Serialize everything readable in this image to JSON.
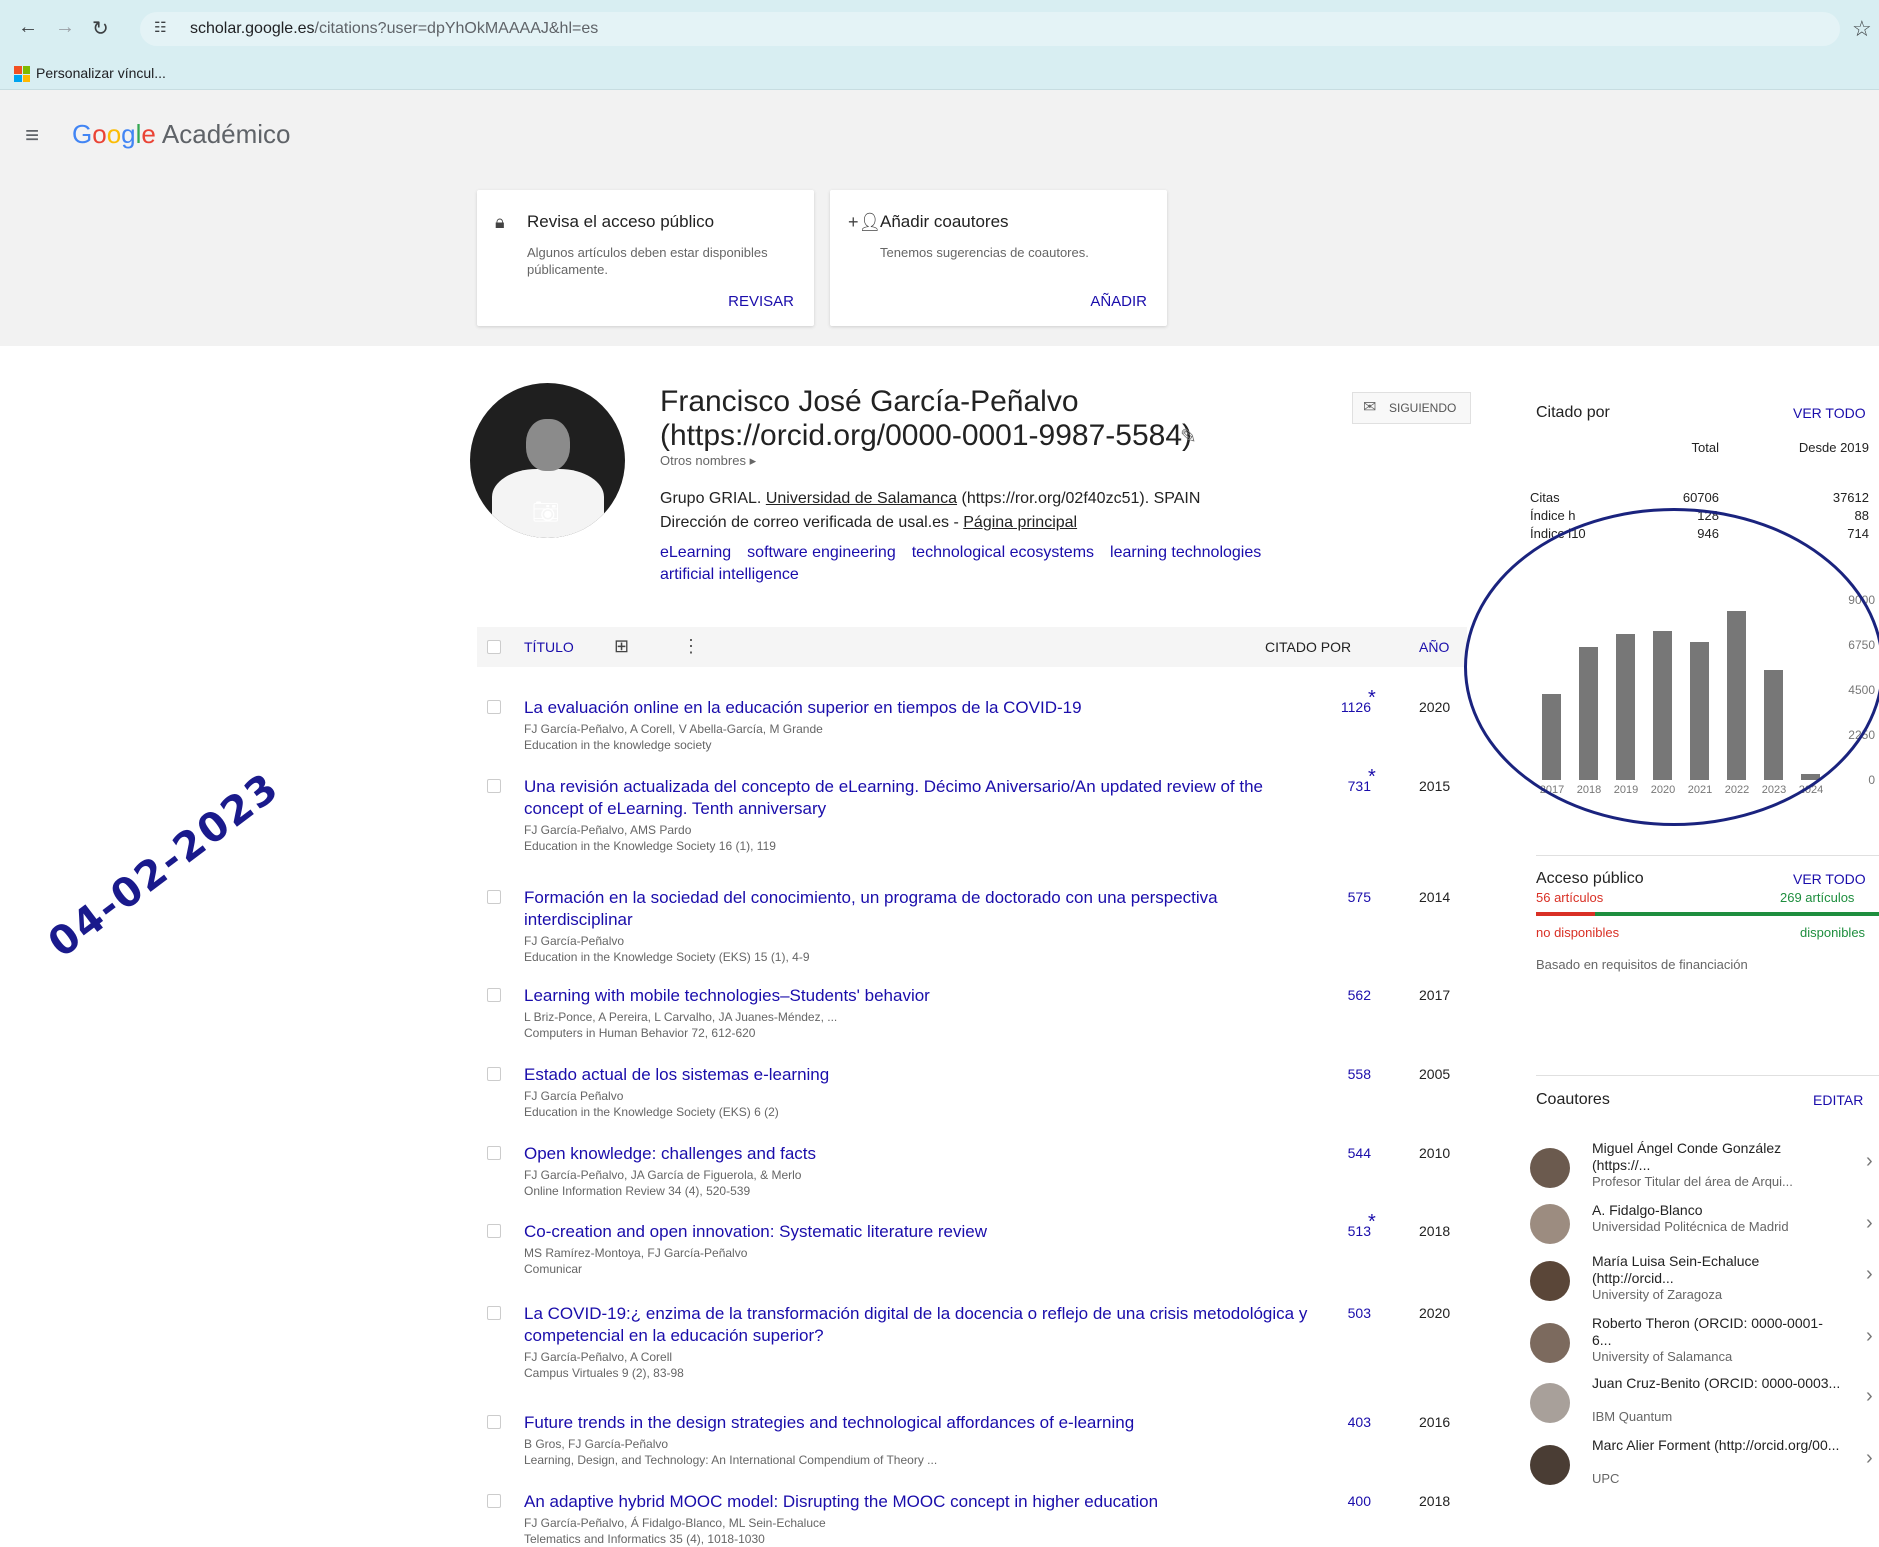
{
  "browser": {
    "url_host": "scholar.google.es",
    "url_path": "/citations?user=dpYhOkMAAAAJ&hl=es",
    "bookmark": "Personalizar víncul...",
    "icons": {
      "back": "back-arrow-icon",
      "forward": "forward-arrow-icon",
      "reload": "reload-icon",
      "site_settings": "tune-icon",
      "bookmark_star": "star-icon"
    }
  },
  "header": {
    "brand_google": "Google",
    "brand_product": "Académico"
  },
  "cards": [
    {
      "title": "Revisa el acceso público",
      "desc": "Algunos artículos deben estar disponibles públicamente.",
      "action": "REVISAR",
      "icon": "lock-icon"
    },
    {
      "title": "Añadir coautores",
      "desc": "Tenemos sugerencias de coautores.",
      "action": "AÑADIR",
      "icon": "add-person-icon"
    }
  ],
  "profile": {
    "name": "Francisco José García-Peñalvo (https://orcid.org/0000-0001-9987-5584)",
    "other_names": "Otros nombres ▸",
    "affil_prefix": "Grupo GRIAL. ",
    "affil_link": "Universidad de Salamanca",
    "affil_suffix": " (https://ror.org/02f40zc51). SPAIN",
    "email_prefix": "Dirección de correo verificada de usal.es - ",
    "email_link": "Página principal",
    "interests": [
      "eLearning",
      "software engineering",
      "technological ecosystems",
      "learning technologies",
      "artificial intelligence"
    ],
    "follow": "SIGUIENDO"
  },
  "table": {
    "header": {
      "title": "TÍTULO",
      "cited": "CITADO POR",
      "year": "AÑO"
    },
    "rows": [
      {
        "title": "La evaluación online en la educación superior en tiempos de la COVID-19",
        "authors": "FJ García-Peñalvo, A Corell, V Abella-García, M Grande",
        "venue": "Education in the knowledge society",
        "cited": "1126",
        "star": "*",
        "year": "2020"
      },
      {
        "title": "Una revisión actualizada del concepto de eLearning. Décimo Aniversario/An updated review of the concept of eLearning. Tenth anniversary",
        "authors": "FJ García-Peñalvo, AMS Pardo",
        "venue": "Education in the Knowledge Society 16 (1), 119",
        "cited": "731",
        "star": "*",
        "year": "2015"
      },
      {
        "title": "Formación en la sociedad del conocimiento, un programa de doctorado con una perspectiva interdisciplinar",
        "authors": "FJ García-Peñalvo",
        "venue": "Education in the Knowledge Society (EKS) 15 (1), 4-9",
        "cited": "575",
        "star": "",
        "year": "2014"
      },
      {
        "title": "Learning with mobile technologies–Students' behavior",
        "authors": "L Briz-Ponce, A Pereira, L Carvalho, JA Juanes-Méndez, ...",
        "venue": "Computers in Human Behavior 72, 612-620",
        "cited": "562",
        "star": "",
        "year": "2017"
      },
      {
        "title": "Estado actual de los sistemas e-learning",
        "authors": "FJ García Peñalvo",
        "venue": "Education in the Knowledge Society (EKS) 6 (2)",
        "cited": "558",
        "star": "",
        "year": "2005"
      },
      {
        "title": "Open knowledge: challenges and facts",
        "authors": "FJ García-Peñalvo, JA García de Figuerola, & Merlo",
        "venue": "Online Information Review 34 (4), 520-539",
        "cited": "544",
        "star": "",
        "year": "2010"
      },
      {
        "title": "Co-creation and open innovation: Systematic literature review",
        "authors": "MS Ramírez-Montoya, FJ García-Peñalvo",
        "venue": "Comunicar",
        "cited": "513",
        "star": "*",
        "year": "2018"
      },
      {
        "title": "La COVID-19:¿ enzima de la transformación digital de la docencia o reflejo de una crisis metodológica y competencial en la educación superior?",
        "authors": "FJ García-Peñalvo, A Corell",
        "venue": "Campus Virtuales 9 (2), 83-98",
        "cited": "503",
        "star": "",
        "year": "2020"
      },
      {
        "title": "Future trends in the design strategies and technological affordances of e-learning",
        "authors": "B Gros, FJ García-Peñalvo",
        "venue": "Learning, Design, and Technology: An International Compendium of Theory ...",
        "cited": "403",
        "star": "",
        "year": "2016"
      },
      {
        "title": "An adaptive hybrid MOOC model: Disrupting the MOOC concept in higher education",
        "authors": "FJ García-Peñalvo, Á Fidalgo-Blanco, ML Sein-Echaluce",
        "venue": "Telematics and Informatics 35 (4), 1018-1030",
        "cited": "400",
        "star": "",
        "year": "2018"
      }
    ]
  },
  "cited_by": {
    "title": "Citado por",
    "link": "VER TODO",
    "col_total": "Total",
    "col_since": "Desde 2019",
    "rows": [
      {
        "label": "Citas",
        "total": "60706",
        "since": "37612"
      },
      {
        "label": "Índice h",
        "total": "128",
        "since": "88"
      },
      {
        "label": "Índice i10",
        "total": "946",
        "since": "714"
      }
    ]
  },
  "chart_data": {
    "type": "bar",
    "categories": [
      "2017",
      "2018",
      "2019",
      "2020",
      "2021",
      "2022",
      "2023",
      "2024"
    ],
    "values": [
      4300,
      6650,
      7300,
      7450,
      6900,
      8450,
      5500,
      280
    ],
    "ylim": [
      0,
      9000
    ],
    "yticks": [
      "9000",
      "6750",
      "4500",
      "2250",
      "0"
    ],
    "xlabel": "",
    "ylabel": "",
    "color": "#777777"
  },
  "public_access": {
    "title": "Acceso público",
    "link": "VER TODO",
    "unavailable_count": "56 artículos",
    "available_count": "269 artículos",
    "unavailable_label": "no disponibles",
    "available_label": "disponibles",
    "note": "Basado en requisitos de financiación",
    "fraction_unavailable": 0.17
  },
  "coauthors": {
    "title": "Coautores",
    "link": "EDITAR",
    "items": [
      {
        "name": "Miguel Ángel Conde González (https://...",
        "aff": "Profesor Titular del área de Arqui..."
      },
      {
        "name": "A. Fidalgo-Blanco",
        "aff": "Universidad Politécnica de Madrid"
      },
      {
        "name": "María Luisa Sein-Echaluce (http://orcid...",
        "aff": "University of Zaragoza"
      },
      {
        "name": "Roberto Theron (ORCID: 0000-0001-6...",
        "aff": "University of Salamanca"
      },
      {
        "name": "Juan Cruz-Benito (ORCID: 0000-0003...",
        "aff": "IBM Quantum"
      },
      {
        "name": "Marc Alier Forment (http://orcid.org/00...",
        "aff": "UPC"
      }
    ]
  },
  "stamp": {
    "date": "04-02-2023"
  }
}
